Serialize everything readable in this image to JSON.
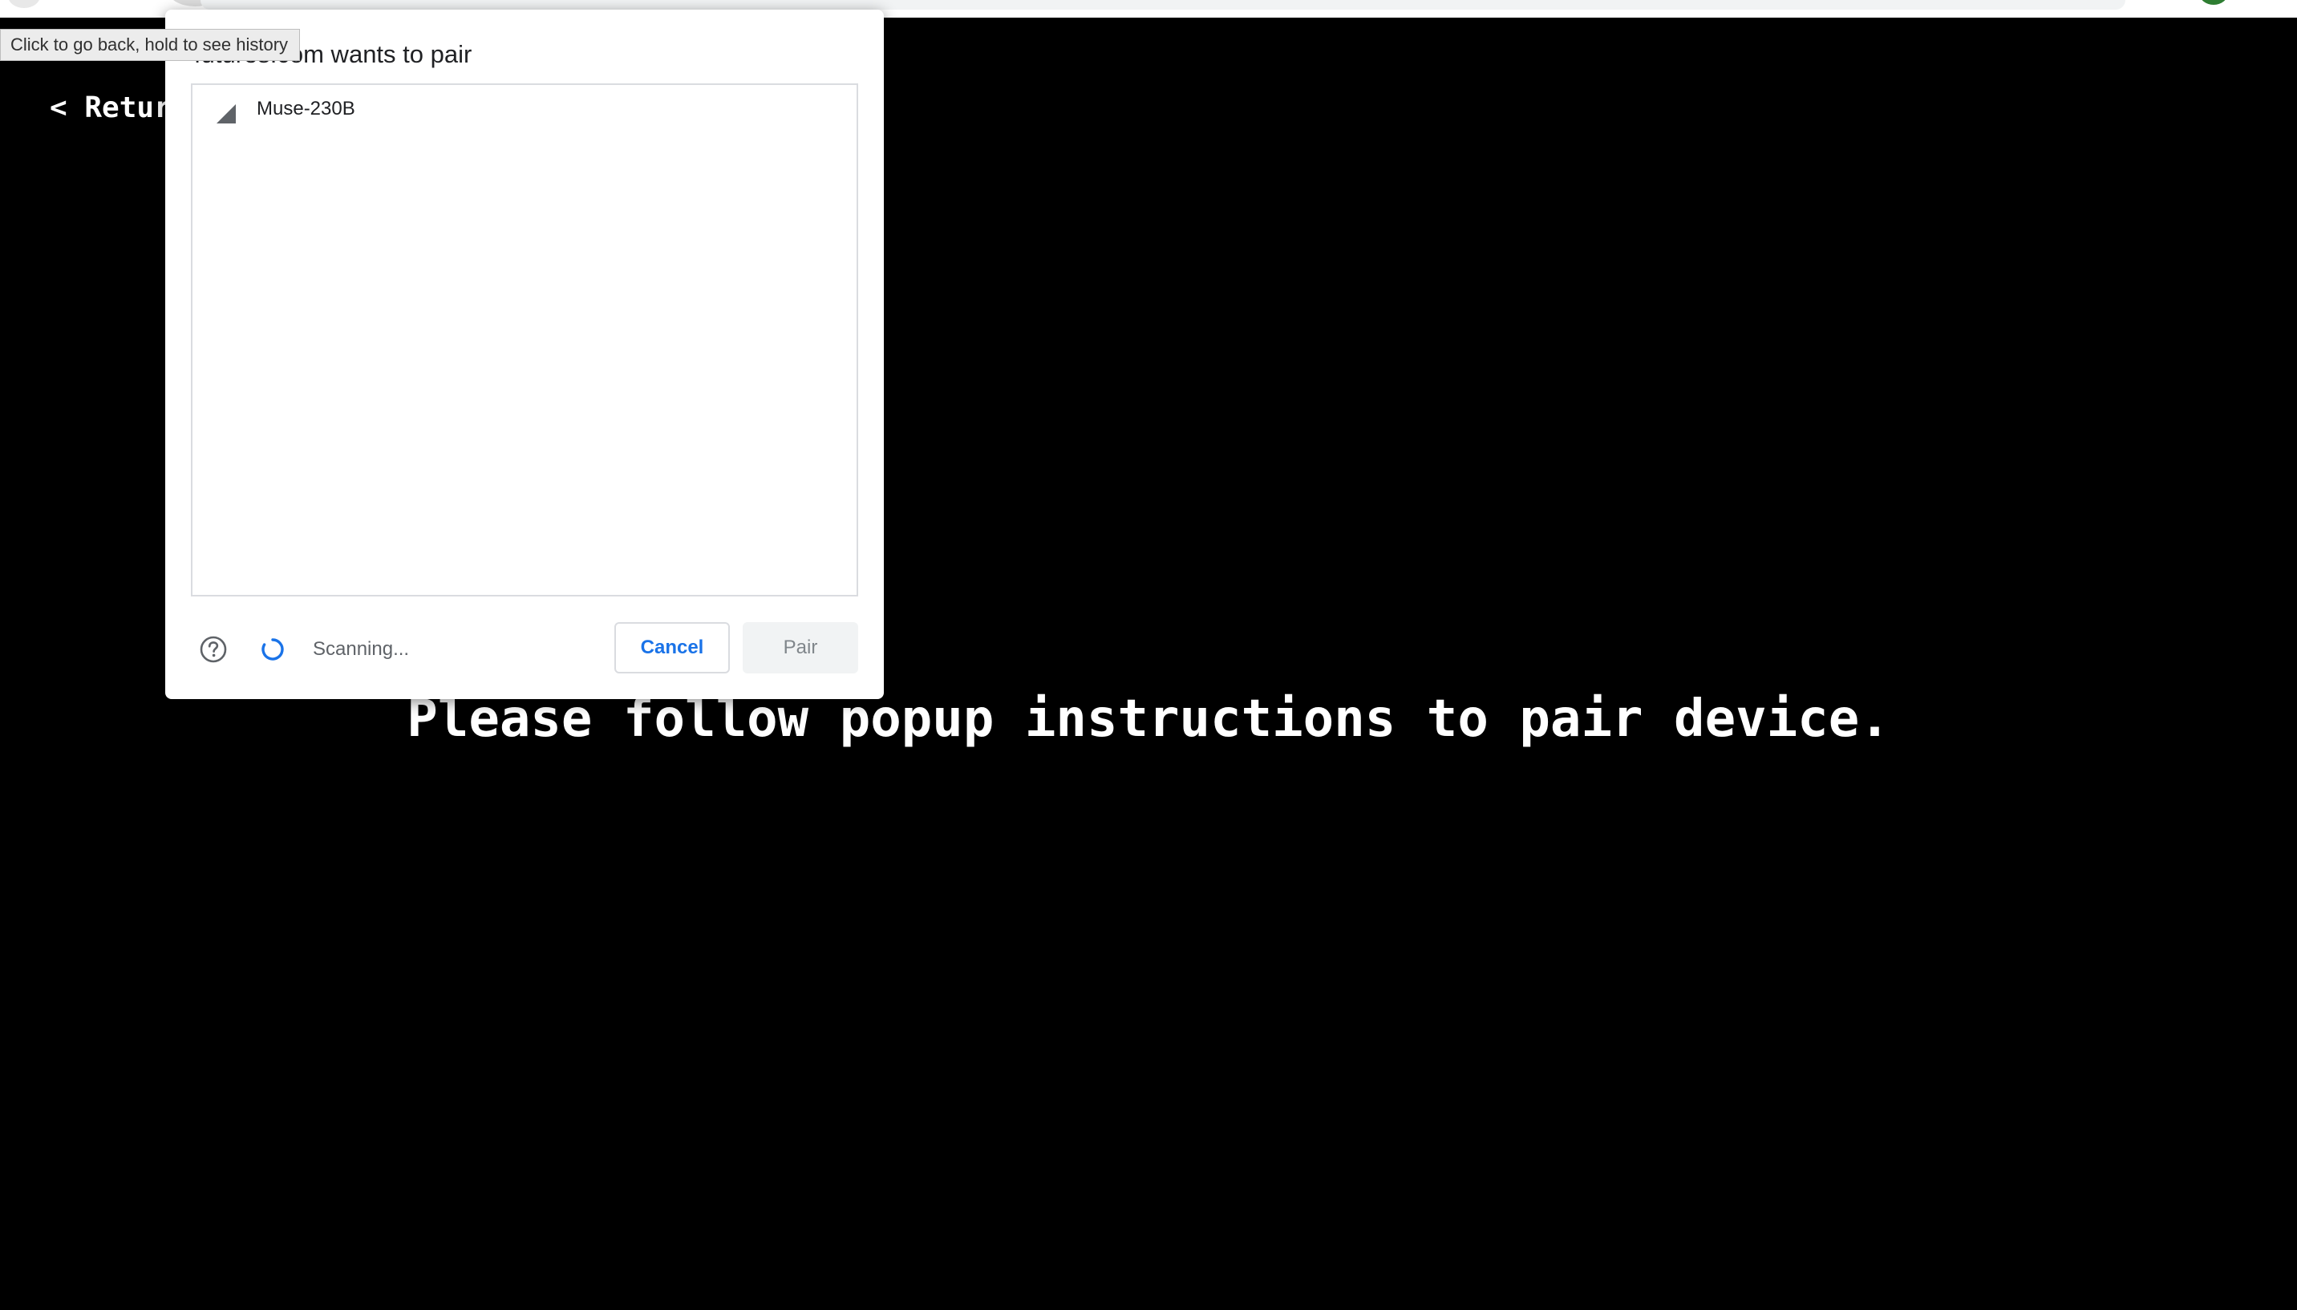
{
  "page": {
    "return_label": "< Return",
    "instructions": "Please follow popup instructions to pair device."
  },
  "dialog": {
    "title": "futures.com wants to pair",
    "devices": [
      {
        "name": "Muse-230B",
        "icon": "signal-strength-icon"
      }
    ],
    "status": "Scanning...",
    "cancel_label": "Cancel",
    "pair_label": "Pair",
    "help_icon": "help-icon",
    "spinner_icon": "spinner-icon"
  },
  "tooltip": {
    "text": "Click to go back, hold to see history"
  },
  "colors": {
    "page_background": "#000000",
    "page_text": "#ffffff",
    "accent_blue": "#1a73e8",
    "dialog_background": "#ffffff"
  }
}
